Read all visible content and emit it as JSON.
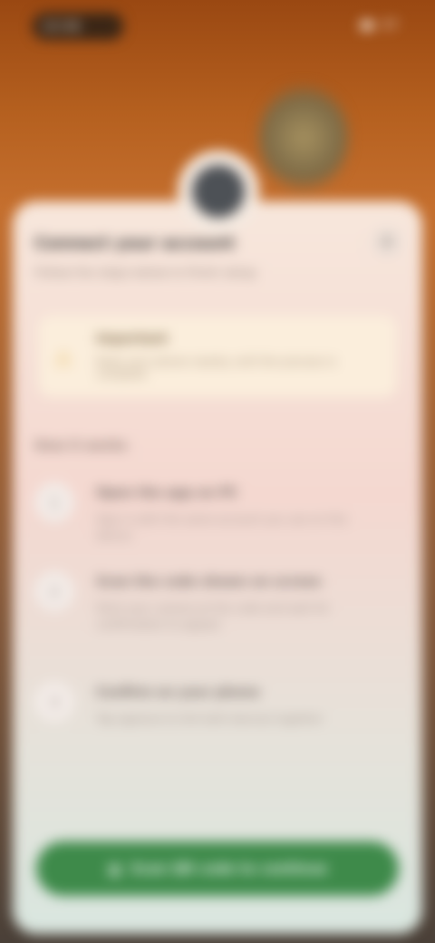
{
  "status": {
    "time": "10:06",
    "battery": "87"
  },
  "sheet": {
    "title": "Connect your account",
    "subtitle": "Follow the steps below to finish setup",
    "close_icon": "close-icon"
  },
  "notice": {
    "title": "Important",
    "text": "Keep your phone nearby until the process is complete"
  },
  "steps": {
    "section_title": "How it works",
    "items": [
      {
        "number": "1",
        "title": "Open the app on PC",
        "desc": "Sign in with the same account you use on this device"
      },
      {
        "number": "2",
        "title": "Scan the code shown on screen",
        "desc": "Point your camera at the code and wait for confirmation to appear"
      },
      {
        "number": "3",
        "title": "Confirm on your phone",
        "desc": "Tap approve to link both devices together"
      }
    ]
  },
  "cta": {
    "label": "Scan QR code to continue",
    "icon": "qr-icon"
  },
  "colors": {
    "accent": "#3e8a4a",
    "background": "#b5601f"
  }
}
